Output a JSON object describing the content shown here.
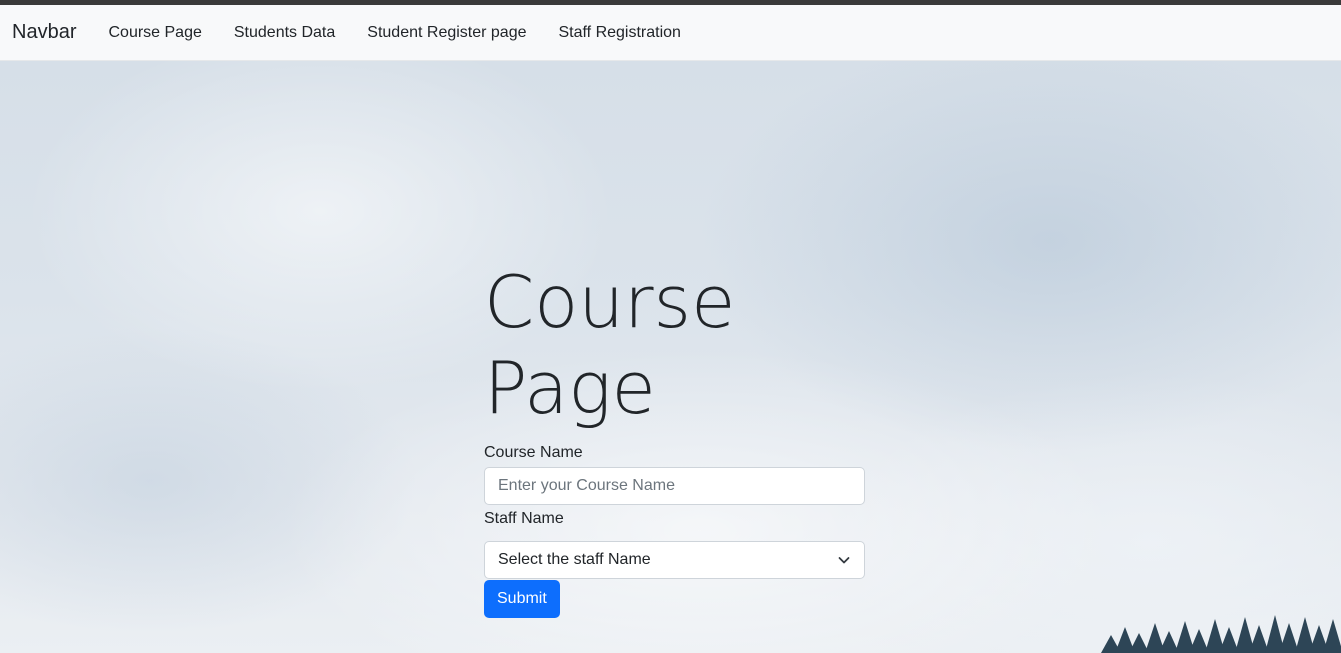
{
  "navbar": {
    "brand": "Navbar",
    "links": [
      {
        "label": "Course Page"
      },
      {
        "label": "Students Data"
      },
      {
        "label": "Student Register page"
      },
      {
        "label": "Staff Registration"
      }
    ]
  },
  "form": {
    "title": "Course Page",
    "course_label": "Course Name",
    "course_placeholder": "Enter your Course Name",
    "staff_label": "Staff Name",
    "staff_selected": "Select the staff Name",
    "submit_label": "Submit"
  },
  "colors": {
    "primary": "#0d6efd",
    "navbar_bg": "#f8f9fa",
    "text": "#212529"
  },
  "icons": {
    "select_chevron": "chevron-down-icon"
  }
}
